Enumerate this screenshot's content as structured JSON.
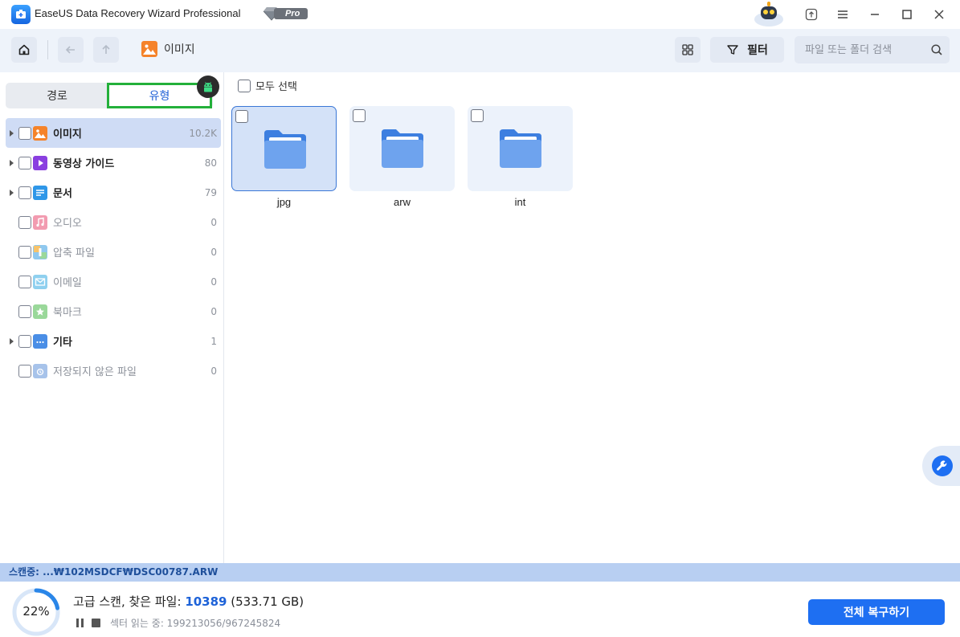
{
  "titlebar": {
    "app_title": "EaseUS Data Recovery Wizard Professional",
    "badge": "Pro",
    "icons": [
      "app-logo-icon",
      "diamond-icon",
      "robot-avatar-icon",
      "upload-icon",
      "menu-icon",
      "minimize-icon",
      "maximize-icon",
      "close-icon"
    ]
  },
  "toolbar": {
    "breadcrumb": "이미지",
    "filter_label": "필터",
    "search_placeholder": "파일 또는 폴더 검색",
    "icons": [
      "home-icon",
      "back-arrow-icon",
      "up-arrow-icon",
      "grid-view-icon",
      "filter-icon",
      "search-icon"
    ]
  },
  "leftpanel": {
    "tabs": [
      {
        "label": "경로",
        "active": false
      },
      {
        "label": "유형",
        "active": true
      }
    ],
    "tree": [
      {
        "label": "이미지",
        "count": "10.2K",
        "expandable": true,
        "selected": true,
        "dim": false,
        "icon": "image-icon",
        "color": "#f5832a"
      },
      {
        "label": "동영상 가이드",
        "count": "80",
        "expandable": true,
        "selected": false,
        "dim": false,
        "icon": "video-icon",
        "color": "#8a3fe0"
      },
      {
        "label": "문서",
        "count": "79",
        "expandable": true,
        "selected": false,
        "dim": false,
        "icon": "document-icon",
        "color": "#2f97e8"
      },
      {
        "label": "오디오",
        "count": "0",
        "expandable": false,
        "selected": false,
        "dim": true,
        "icon": "audio-icon",
        "color": "#f29bb0"
      },
      {
        "label": "압축 파일",
        "count": "0",
        "expandable": false,
        "selected": false,
        "dim": true,
        "icon": "archive-icon",
        "color": "#8fc8ef"
      },
      {
        "label": "이메일",
        "count": "0",
        "expandable": false,
        "selected": false,
        "dim": true,
        "icon": "email-icon",
        "color": "#8fd0ef"
      },
      {
        "label": "북마크",
        "count": "0",
        "expandable": false,
        "selected": false,
        "dim": true,
        "icon": "bookmark-icon",
        "color": "#9ad89a"
      },
      {
        "label": "기타",
        "count": "1",
        "expandable": true,
        "selected": false,
        "dim": false,
        "icon": "other-folder-icon",
        "color": "#4a8ee6"
      },
      {
        "label": "저장되지 않은 파일",
        "count": "0",
        "expandable": false,
        "selected": false,
        "dim": true,
        "icon": "unsaved-file-icon",
        "color": "#a7c3ea"
      }
    ]
  },
  "content": {
    "select_all": "모두 선택",
    "folders": [
      {
        "name": "jpg",
        "selected": true
      },
      {
        "name": "arw",
        "selected": false
      },
      {
        "name": "int",
        "selected": false
      }
    ]
  },
  "scan": {
    "strip_text": "스캔중: ...₩102MSDCF₩DSC00787.ARW",
    "progress_value": 22,
    "progress_label": "22%",
    "title_prefix": "고급 스캔, 찾은 파일:",
    "found_count": "10389",
    "found_size": "(533.71 GB)",
    "sector_text": "섹터 읽는 중: 199213056/967245824"
  },
  "actions": {
    "recover_all": "전체 복구하기"
  },
  "colors": {
    "accent": "#1e6ff2",
    "selection": "#cfdcf5",
    "highlight_border": "#23b03a"
  }
}
